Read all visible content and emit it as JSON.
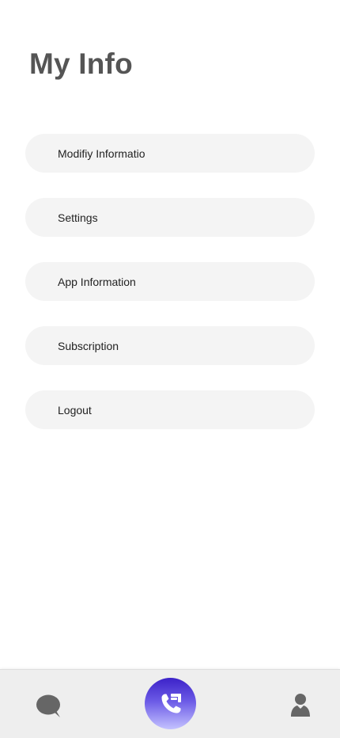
{
  "page": {
    "title": "My Info"
  },
  "menu": {
    "items": [
      {
        "label": "Modifiy Informatio"
      },
      {
        "label": "Settings"
      },
      {
        "label": "App Information"
      },
      {
        "label": "Subscription"
      },
      {
        "label": "Logout"
      }
    ]
  },
  "bottom_nav": {
    "items": [
      {
        "icon": "chat-bubble-icon"
      },
      {
        "icon": "phone-call-icon",
        "accent": "#3c22c8"
      },
      {
        "icon": "user-profile-icon"
      }
    ]
  },
  "colors": {
    "title": "#555555",
    "menu_background": "#f4f4f4",
    "nav_background": "#eeeeee",
    "nav_icon": "#666666",
    "call_gradient_top": "#3c22c8",
    "call_gradient_bottom": "#c4c2ff"
  }
}
